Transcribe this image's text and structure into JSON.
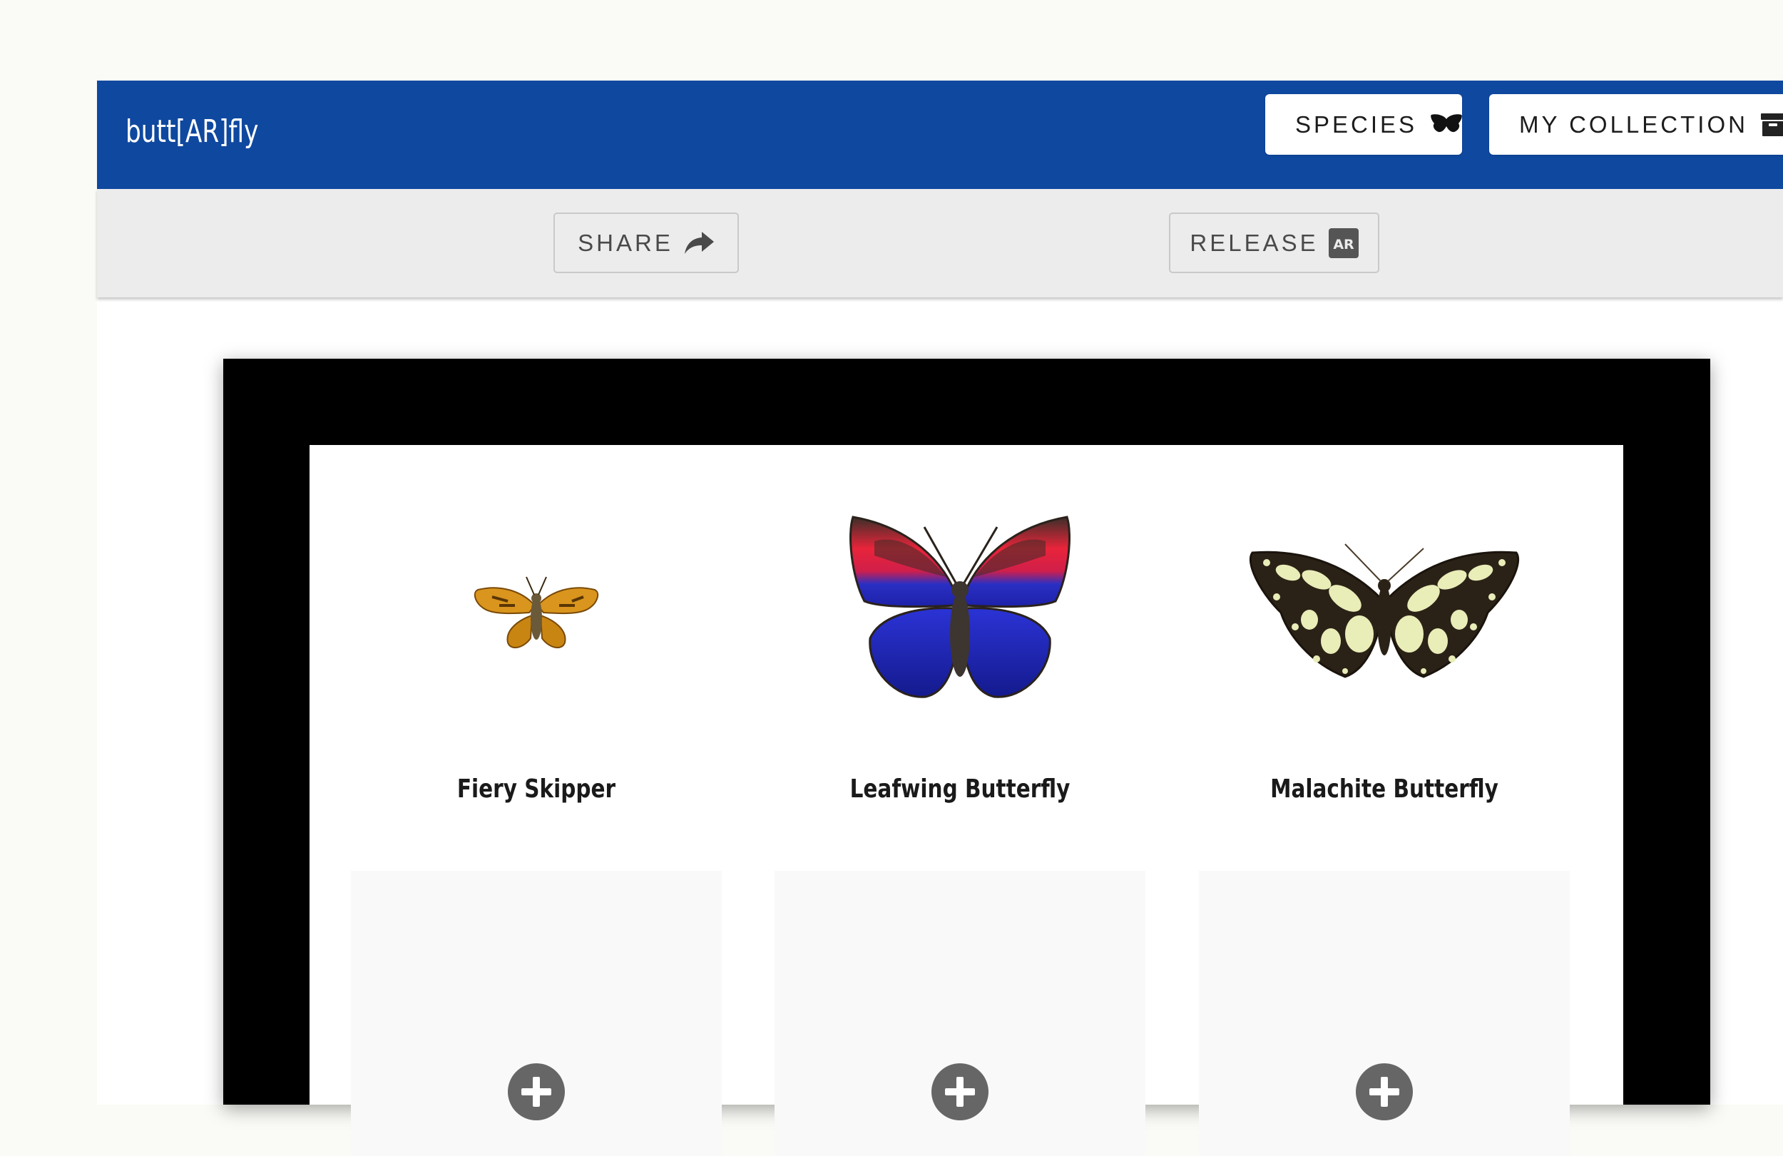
{
  "app": {
    "brand": "butt[AR]fly"
  },
  "nav": {
    "species_label": "SPECIES",
    "collection_label": "MY COLLECTION"
  },
  "toolbar": {
    "share_label": "SHARE",
    "release_label": "RELEASE",
    "release_icon_text": "AR"
  },
  "collection": {
    "specimens": [
      {
        "name": "Fiery Skipper",
        "icon": "fiery-skipper-image"
      },
      {
        "name": "Leafwing Butterfly",
        "icon": "leafwing-butterfly-image"
      },
      {
        "name": "Malachite Butterfly",
        "icon": "malachite-butterfly-image"
      }
    ],
    "empty_slots": 3
  },
  "colors": {
    "brand_blue": "#0f489f",
    "toolbar_gray": "#ececec",
    "frame_black": "#000000",
    "plus_gray": "#666666"
  }
}
